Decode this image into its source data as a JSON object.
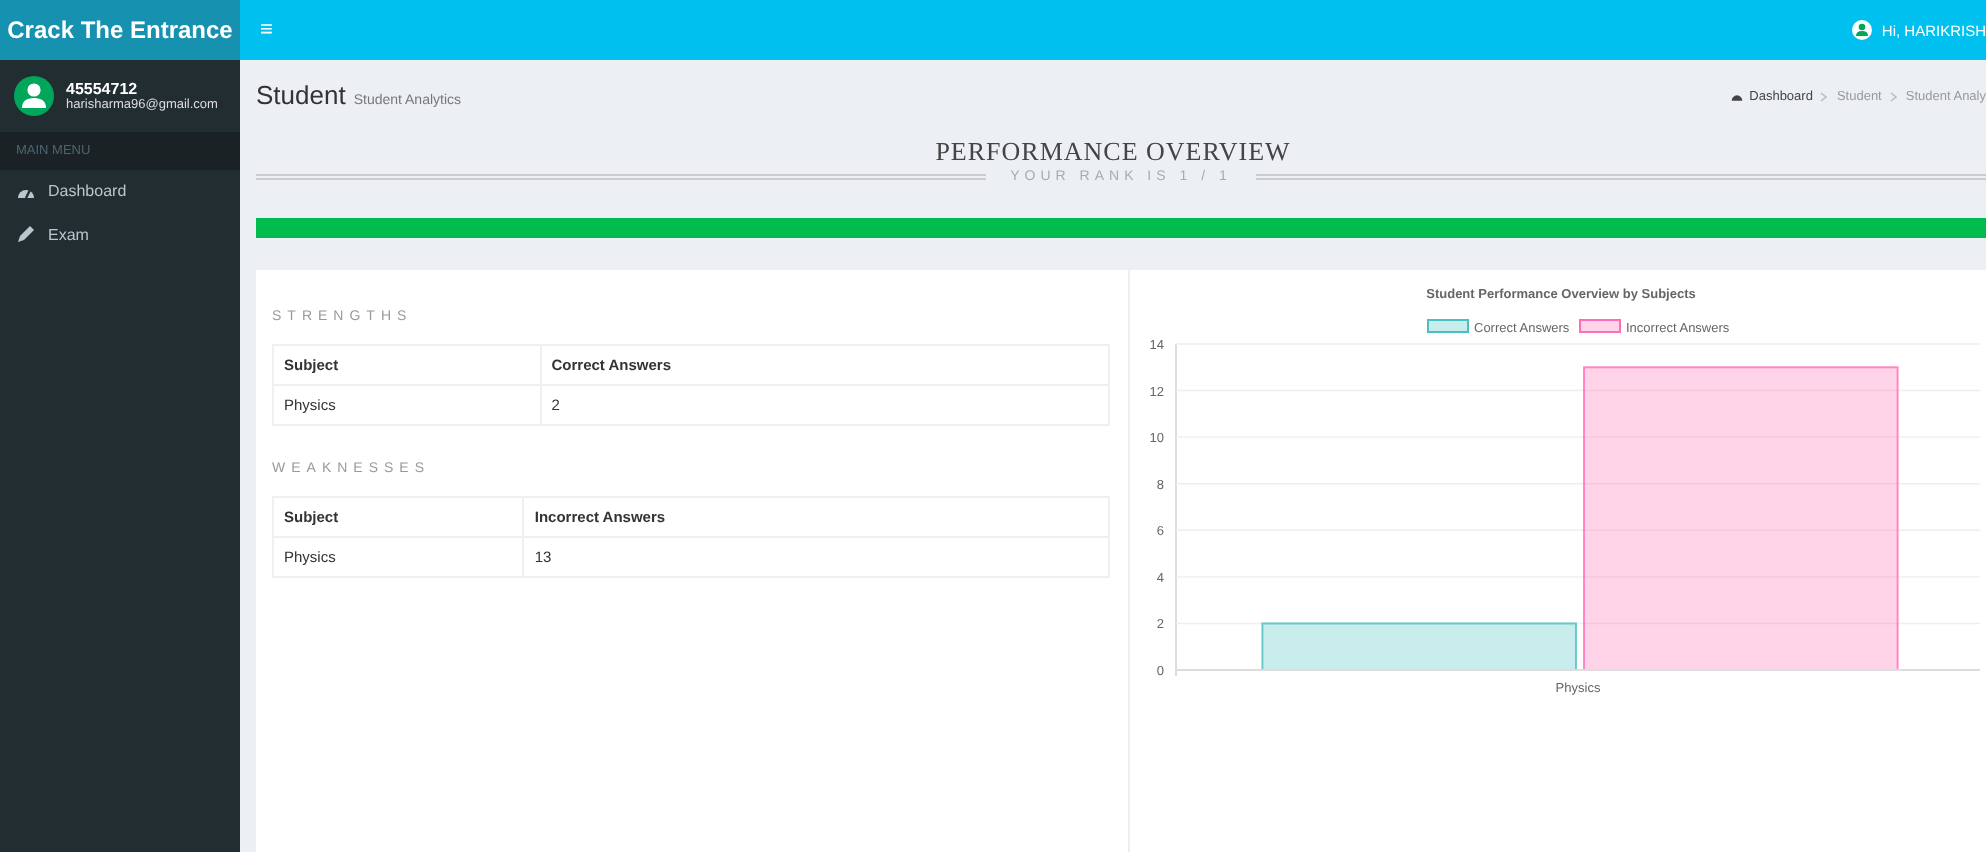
{
  "sidebar": {
    "brand": "Crack The Entrance",
    "user": {
      "id": "45554712",
      "email": "harisharma96@gmail.com"
    },
    "menu_header": "MAIN MENU",
    "items": [
      {
        "kind": "dashboard",
        "label": "Dashboard"
      },
      {
        "kind": "pencil",
        "label": "Exam"
      }
    ]
  },
  "topbar": {
    "menu_glyph": "≡",
    "greeting": "Hi, HARIKRISH"
  },
  "header": {
    "title": "Student",
    "subtitle": "Student Analytics",
    "breadcrumb": [
      "Dashboard",
      "Student",
      "Student Analy"
    ]
  },
  "overview": {
    "title": "PERFORMANCE OVERVIEW",
    "rank": "YOUR RANK IS 1 / 1",
    "progress": {
      "level": 1
    }
  },
  "tables": [
    {
      "title": "STRENGTHS",
      "columns": [
        "Subject",
        "Correct Answers"
      ],
      "rows": [
        [
          "Physics",
          "2"
        ]
      ]
    },
    {
      "title": "WEAKNESSES",
      "columns": [
        "Subject",
        "Incorrect Answers"
      ],
      "rows": [
        [
          "Physics",
          "13"
        ]
      ]
    }
  ],
  "chart": {
    "chart_data": {
      "type": "bar",
      "title": "Student Performance Overview by Subjects",
      "categories": [
        "Physics"
      ],
      "series": [
        {
          "name": "Correct Answers",
          "color": "#4bc0c0",
          "values": [
            2
          ]
        },
        {
          "name": "Incorrect Answers",
          "color": "#ff6fb5",
          "values": [
            13
          ]
        }
      ],
      "grid": true,
      "legend": true,
      "ylim": [
        0,
        14
      ],
      "yticks": [
        {
          "value": 0,
          "label": "0"
        },
        {
          "value": 2,
          "label": "2"
        },
        {
          "value": 4,
          "label": "4"
        },
        {
          "value": 6,
          "label": "6"
        },
        {
          "value": 8,
          "label": "8"
        },
        {
          "value": 10,
          "label": "10"
        },
        {
          "value": 12,
          "label": "12"
        },
        {
          "value": 14,
          "label": "14"
        }
      ]
    }
  }
}
